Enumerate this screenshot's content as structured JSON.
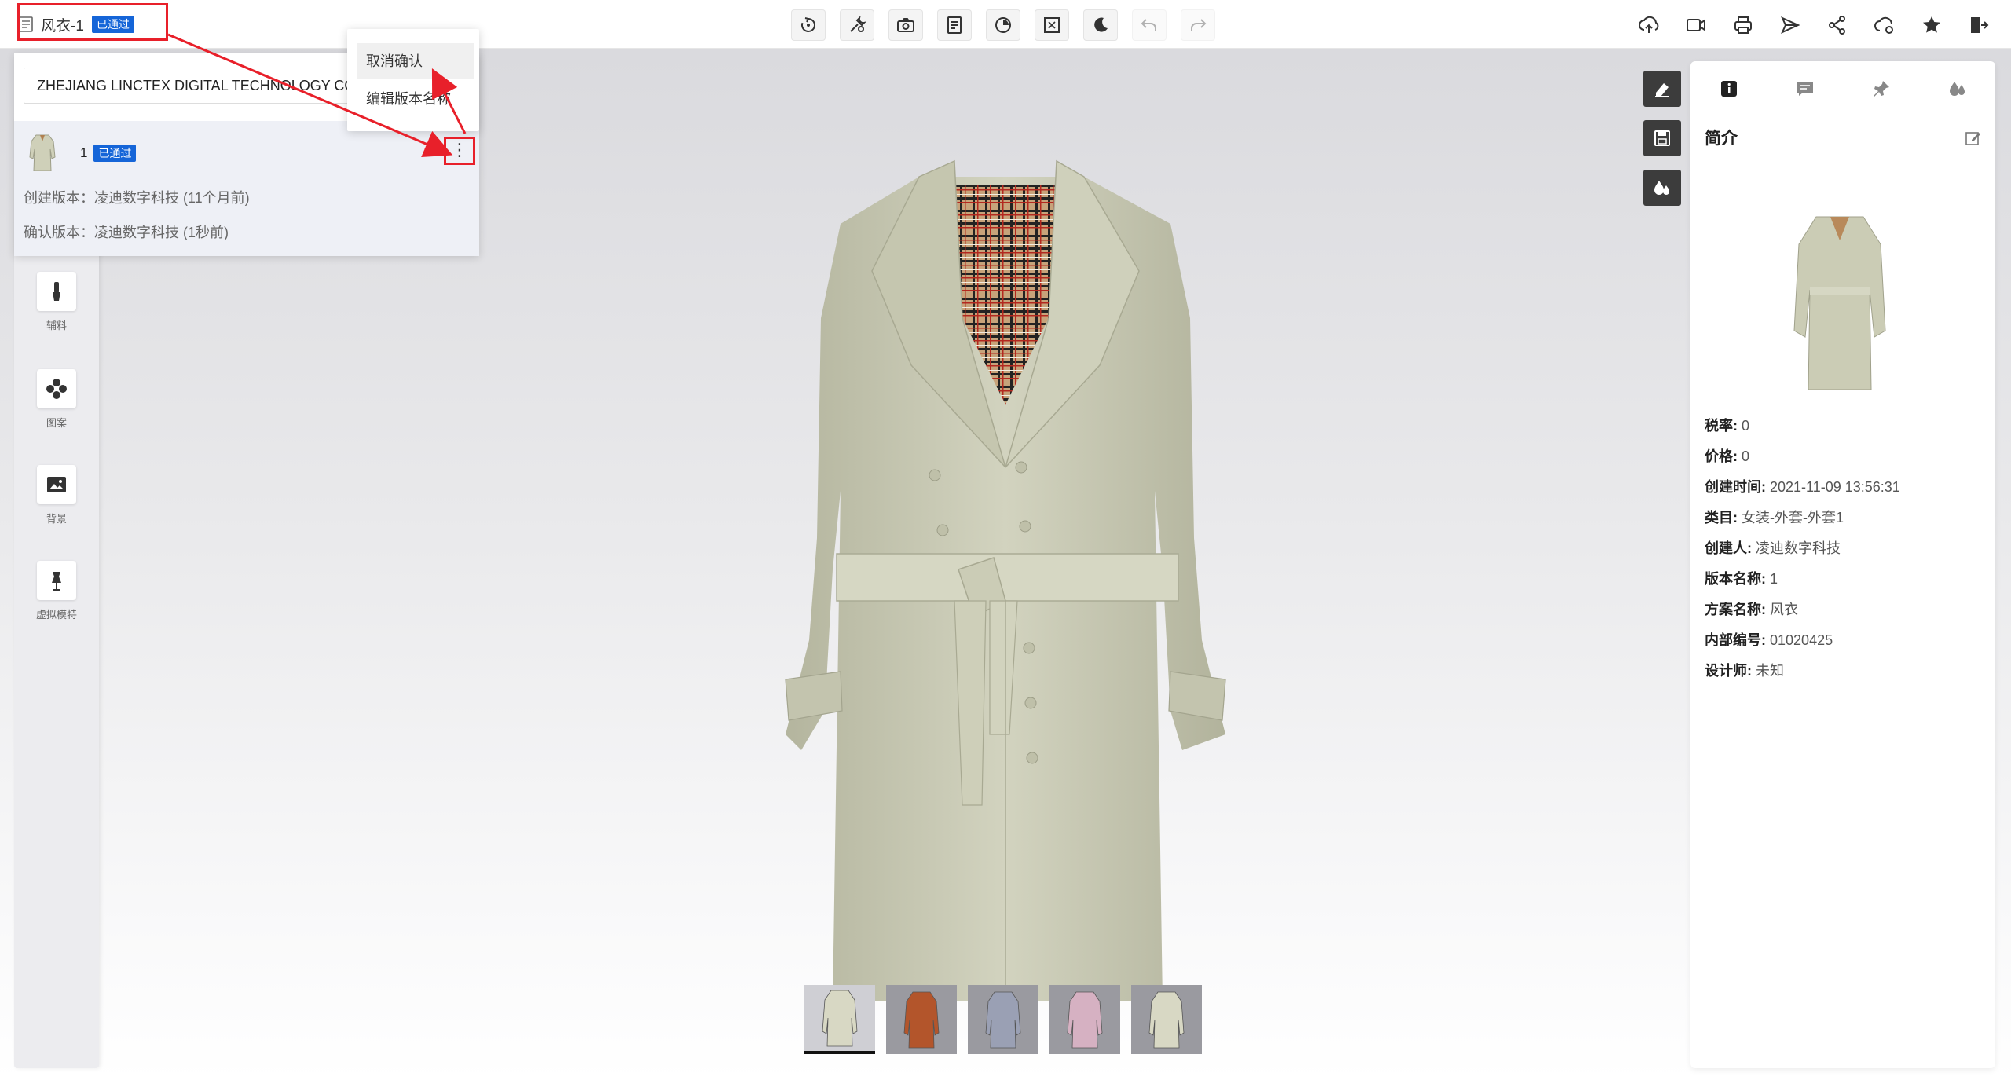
{
  "header": {
    "doc_title": "风衣-1",
    "status_badge": "已通过"
  },
  "toolbar": {
    "center_icons": [
      "rotate-icon",
      "wrench-icon",
      "camera-icon",
      "document-icon",
      "timer-icon",
      "fullscreen-icon",
      "moon-icon",
      "undo-icon",
      "redo-icon"
    ],
    "right_icons": [
      "cloud-upload-icon",
      "video-icon",
      "print-icon",
      "send-icon",
      "share-icon",
      "cloud-settings-icon",
      "star-icon",
      "exit-icon"
    ]
  },
  "version_panel": {
    "company": "ZHEJIANG LINCTEX DIGITAL TECHNOLOGY CO",
    "version_number": "1",
    "version_badge": "已通过",
    "created_line": "创建版本：凌迪数字科技 (11个月前)",
    "confirmed_line": "确认版本：凌迪数字科技 (1秒前)",
    "more_label": "⋮"
  },
  "context_menu": {
    "items": [
      "取消确认",
      "编辑版本名称"
    ]
  },
  "left_tools": [
    {
      "label": "辅料",
      "icon": "zipper-icon"
    },
    {
      "label": "图案",
      "icon": "pattern-icon"
    },
    {
      "label": "背景",
      "icon": "background-icon"
    },
    {
      "label": "虚拟模特",
      "icon": "mannequin-icon"
    }
  ],
  "info_panel": {
    "title": "简介",
    "tabs": [
      "info-icon",
      "comment-icon",
      "pin-icon",
      "color-drops-icon"
    ],
    "fields": [
      {
        "key": "税率:",
        "value": "0"
      },
      {
        "key": "价格:",
        "value": "0"
      },
      {
        "key": "创建时间:",
        "value": "2021-11-09 13:56:31"
      },
      {
        "key": "类目:",
        "value": "女装-外套-外套1"
      },
      {
        "key": "创建人:",
        "value": "凌迪数字科技"
      },
      {
        "key": "版本名称:",
        "value": "1"
      },
      {
        "key": "方案名称:",
        "value": "风衣"
      },
      {
        "key": "内部编号:",
        "value": "01020425"
      },
      {
        "key": "设计师:",
        "value": "未知"
      }
    ]
  },
  "thumbnails": {
    "colors": [
      "#d8d8c4",
      "#b3552b",
      "#9aa0b4",
      "#d6b1c2",
      "#d8d8c4"
    ],
    "active_index": 0
  },
  "colors": {
    "accent": "#1565d8",
    "highlight": "#e8202a",
    "garment": "#c9cab4"
  }
}
